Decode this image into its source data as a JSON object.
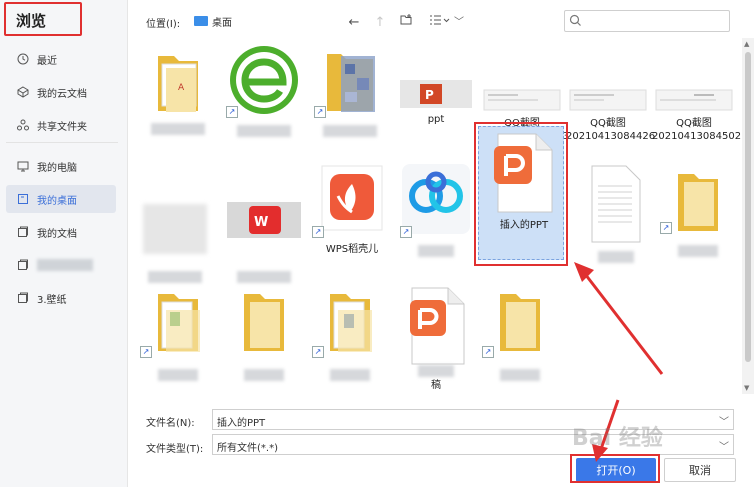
{
  "sidebar": {
    "title": "浏览",
    "items": [
      {
        "label": "最近",
        "icon": "clock-icon"
      },
      {
        "label": "我的云文档",
        "icon": "cloud-doc-icon"
      },
      {
        "label": "共享文件夹",
        "icon": "share-icon"
      },
      {
        "label": "我的电脑",
        "icon": "monitor-icon"
      },
      {
        "label": "我的桌面",
        "icon": "desktop-icon",
        "active": true
      },
      {
        "label": "我的文档",
        "icon": "document-icon"
      },
      {
        "label": "",
        "icon": "folder-icon"
      },
      {
        "label": "3.壁纸",
        "icon": "folder-icon"
      }
    ]
  },
  "toolbar": {
    "location_label": "位置(I):",
    "location_value": "桌面"
  },
  "files": [
    {
      "label": ""
    },
    {
      "label": ""
    },
    {
      "label": ""
    },
    {
      "label": "ppt"
    },
    {
      "label": "QQ截图20210413084403"
    },
    {
      "label": "QQ截图20210413084426"
    },
    {
      "label": "QQ截图20210413084502"
    },
    {
      "label": ""
    },
    {
      "label": ""
    },
    {
      "label": "WPS稻壳儿"
    },
    {
      "label": ""
    },
    {
      "label": "插入的PPT"
    },
    {
      "label": ""
    },
    {
      "label": ""
    },
    {
      "label": ""
    },
    {
      "label": ""
    },
    {
      "label": ""
    },
    {
      "label": "稿"
    },
    {
      "label": ""
    }
  ],
  "footer": {
    "filename_label": "文件名(N):",
    "filename_value": "插入的PPT",
    "filetype_label": "文件类型(T):",
    "filetype_value": "所有文件(*.*)",
    "open_label": "打开(O)",
    "cancel_label": "取消"
  },
  "watermark": "Bai 经验",
  "colors": {
    "accent": "#3a78e8",
    "highlight_red": "#e03030",
    "folder_yellow": "#f2c94c",
    "wps_orange": "#ef6c3a"
  }
}
